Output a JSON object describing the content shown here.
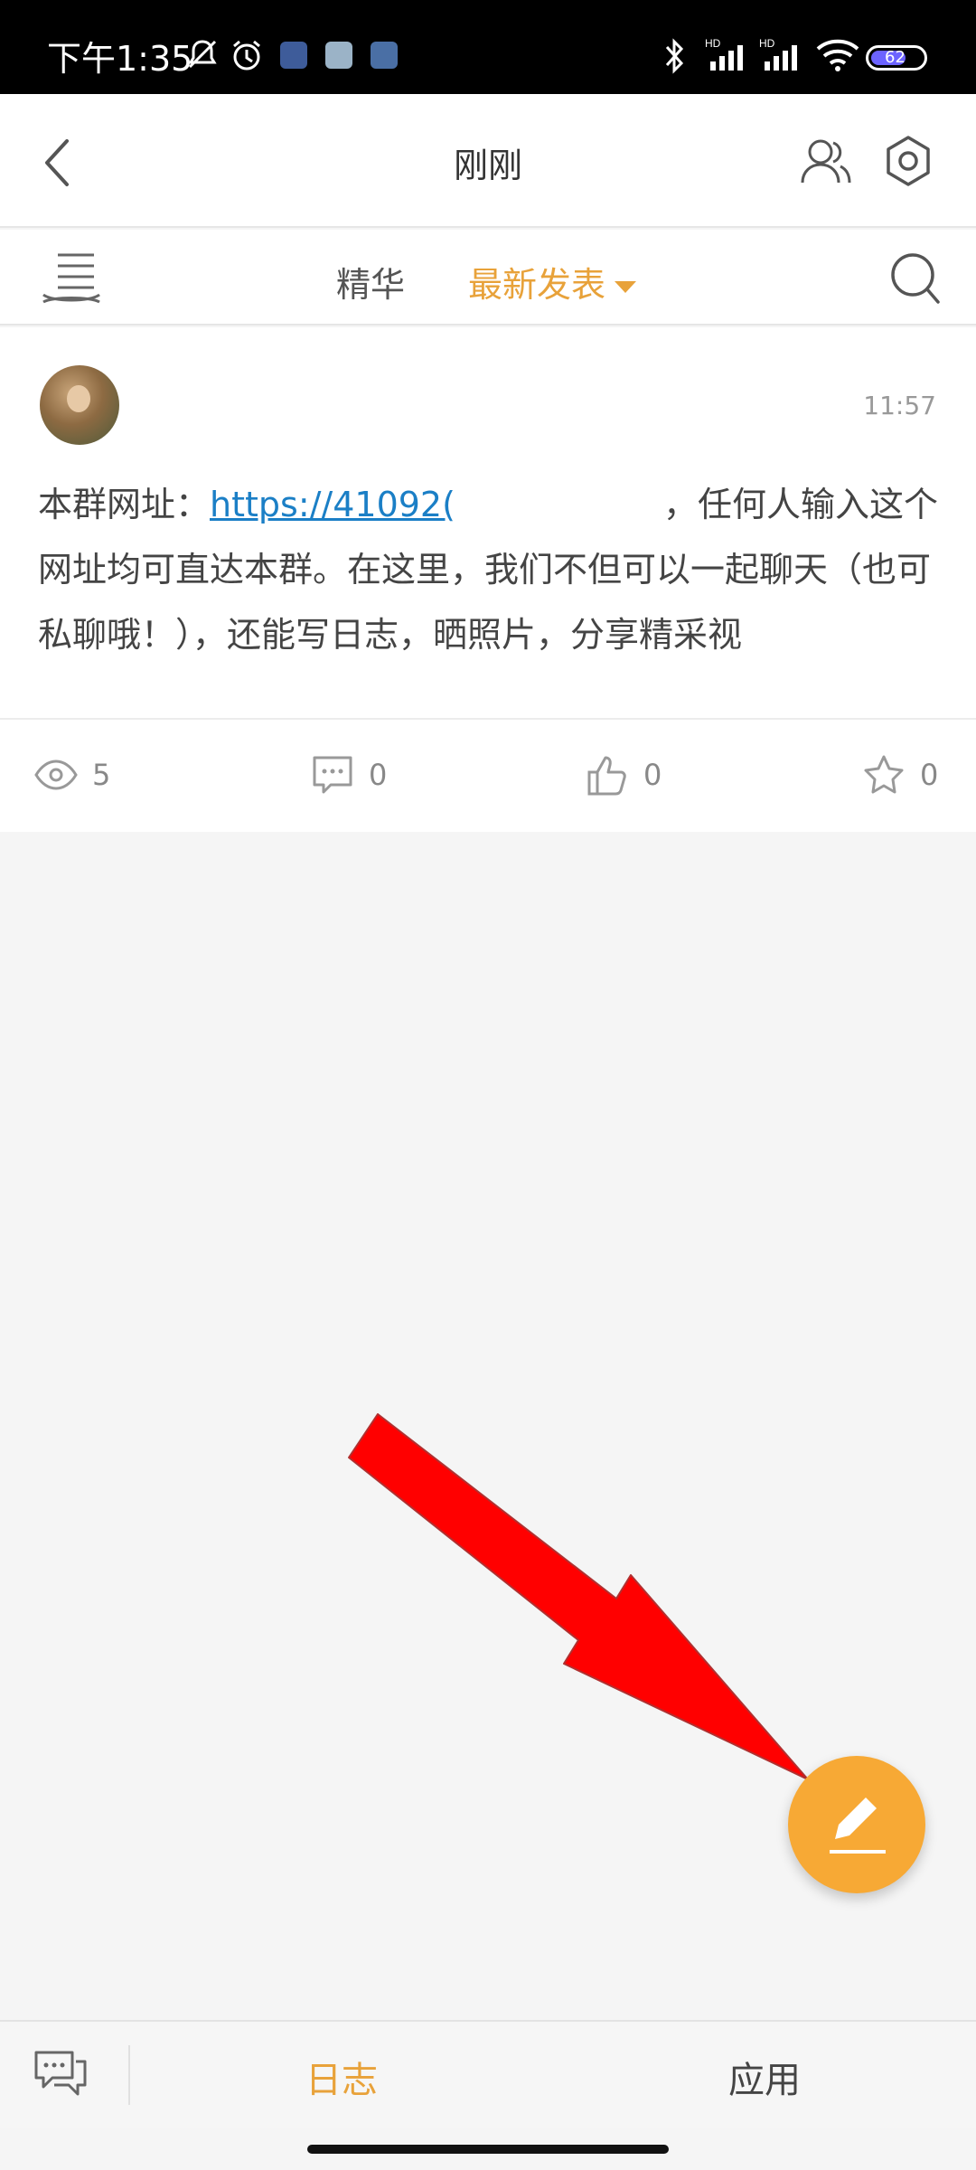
{
  "status_bar": {
    "time": "下午1:35",
    "battery": "62",
    "icons": [
      "mute-icon",
      "alarm-icon",
      "app-icon-1",
      "app-icon-2",
      "app-icon-3",
      "bluetooth-icon",
      "signal-hd-icon",
      "signal-hd-icon-2",
      "wifi-icon",
      "battery-icon"
    ]
  },
  "header": {
    "title": "刚刚"
  },
  "tabs": {
    "featured": "精华",
    "latest": "最新发表"
  },
  "post": {
    "time": "11:57",
    "text_prefix": "本群网址：",
    "link": "https://41092(",
    "text_rest": "，任何人输入这个网址均可直达本群。在这里，我们不但可以一起聊天（也可私聊哦！），还能写日志，晒照片，分享精采视",
    "views": "5",
    "comments": "0",
    "likes": "0",
    "favorites": "0"
  },
  "bottom_nav": {
    "journal": "日志",
    "apps": "应用"
  },
  "colors": {
    "accent": "#e8a23a",
    "fab": "#f7a935",
    "link": "#1b7fc6",
    "annotation_arrow": "#ff0000"
  }
}
